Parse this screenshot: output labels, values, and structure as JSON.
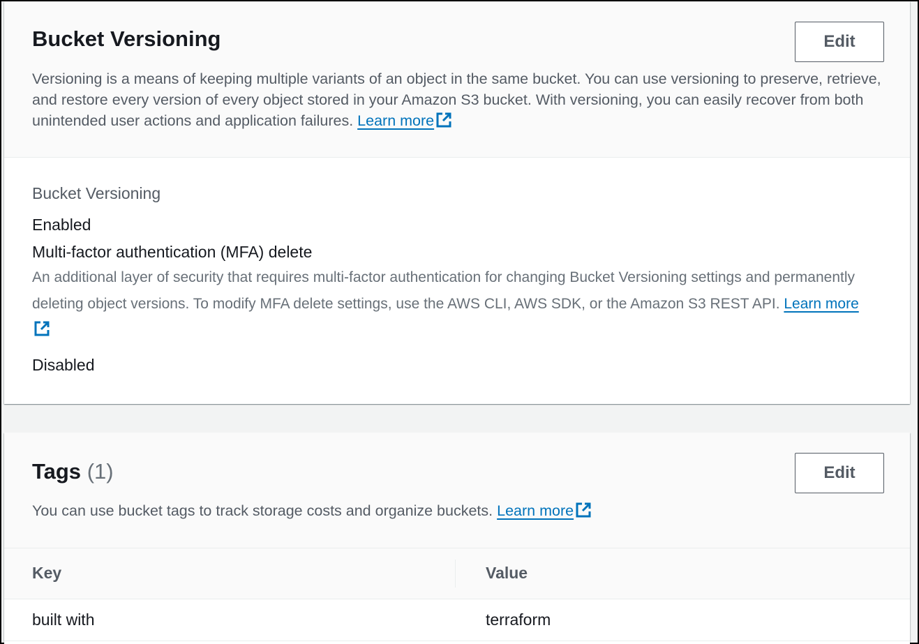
{
  "versioning": {
    "title": "Bucket Versioning",
    "edit_label": "Edit",
    "description": "Versioning is a means of keeping multiple variants of an object in the same bucket. You can use versioning to preserve, retrieve, and restore every version of every object stored in your Amazon S3 bucket. With versioning, you can easily recover from both unintended user actions and application failures.",
    "learn_more": "Learn more",
    "status_label": "Bucket Versioning",
    "status_value": "Enabled",
    "mfa_label": "Multi-factor authentication (MFA) delete",
    "mfa_description": "An additional layer of security that requires multi-factor authentication for changing Bucket Versioning settings and permanently deleting object versions. To modify MFA delete settings, use the AWS CLI, AWS SDK, or the Amazon S3 REST API.",
    "mfa_learn_more": "Learn more",
    "mfa_value": "Disabled"
  },
  "tags": {
    "title": "Tags",
    "count": "(1)",
    "edit_label": "Edit",
    "description": "You can use bucket tags to track storage costs and organize buckets.",
    "learn_more": "Learn more",
    "columns": {
      "key": "Key",
      "value": "Value"
    },
    "rows": [
      {
        "key": "built with",
        "value": "terraform"
      }
    ]
  },
  "icons": {
    "external_link": "external-link-icon"
  },
  "colors": {
    "link": "#0073bb",
    "text": "#16191f",
    "secondary_text": "#545b64",
    "page_bg": "#f2f3f3"
  }
}
